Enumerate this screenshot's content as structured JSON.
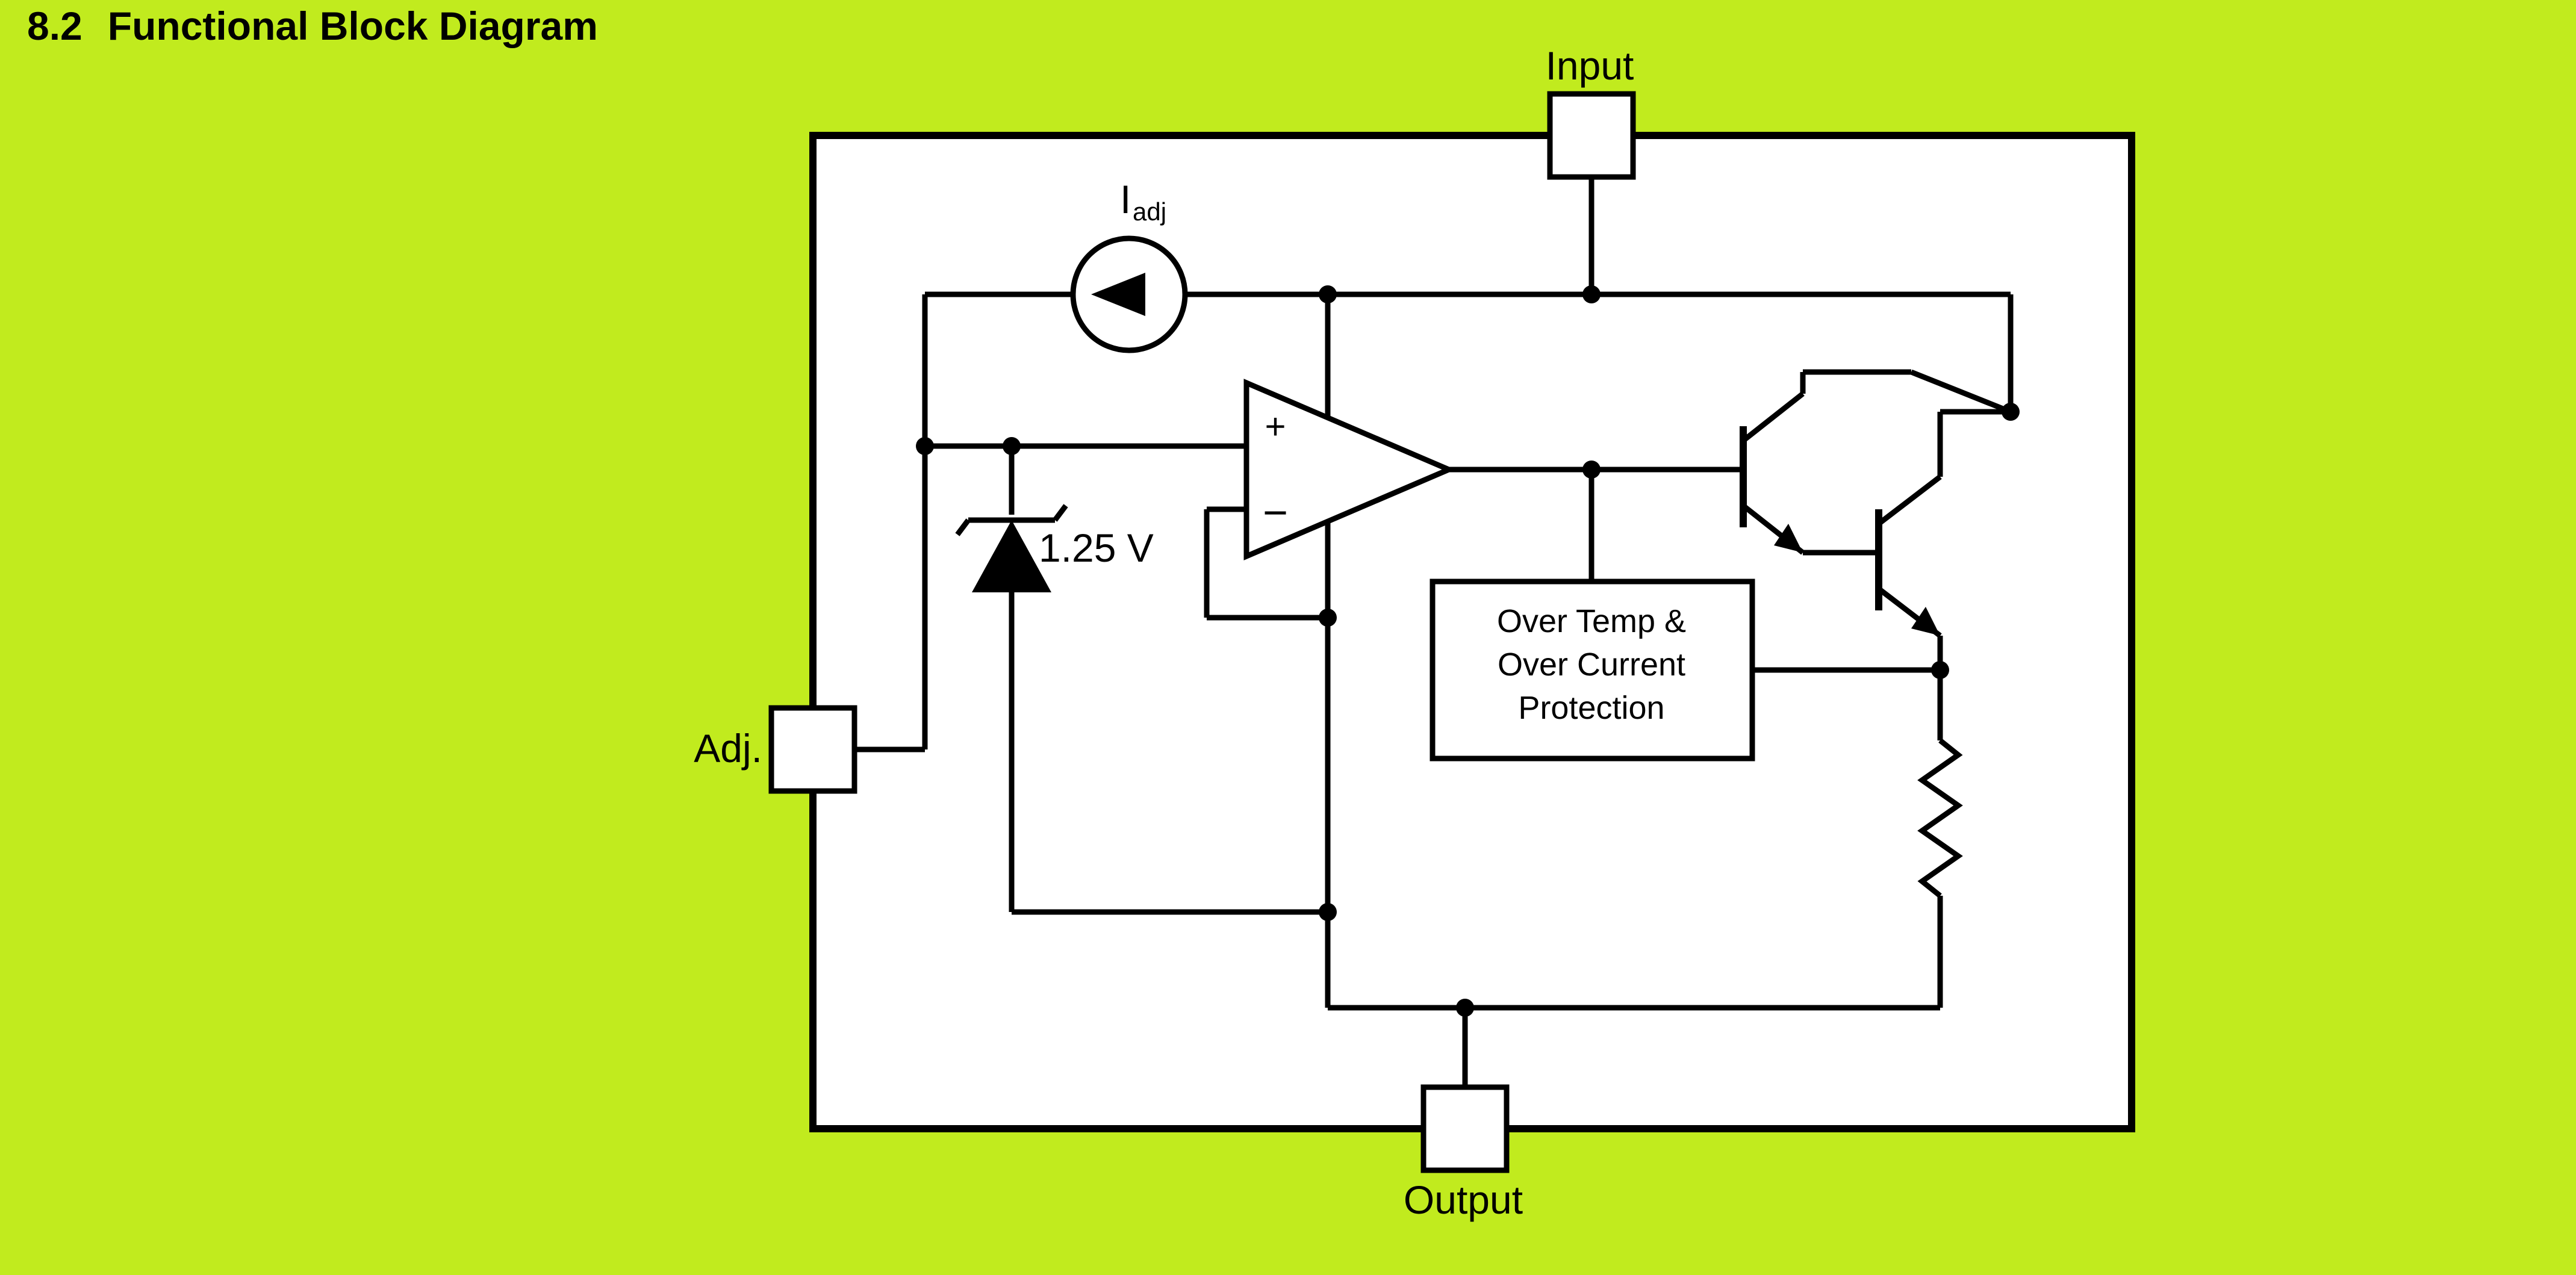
{
  "heading": {
    "number": "8.2",
    "title": "Functional Block Diagram"
  },
  "pins": {
    "input": "Input",
    "output": "Output",
    "adj": "Adj."
  },
  "labels": {
    "iadj": "Iadj",
    "vref": "1.25 V",
    "opamp_plus": "+",
    "opamp_minus": "−"
  },
  "protection": {
    "line1": "Over Temp &",
    "line2": "Over Current",
    "line3": "Protection"
  }
}
